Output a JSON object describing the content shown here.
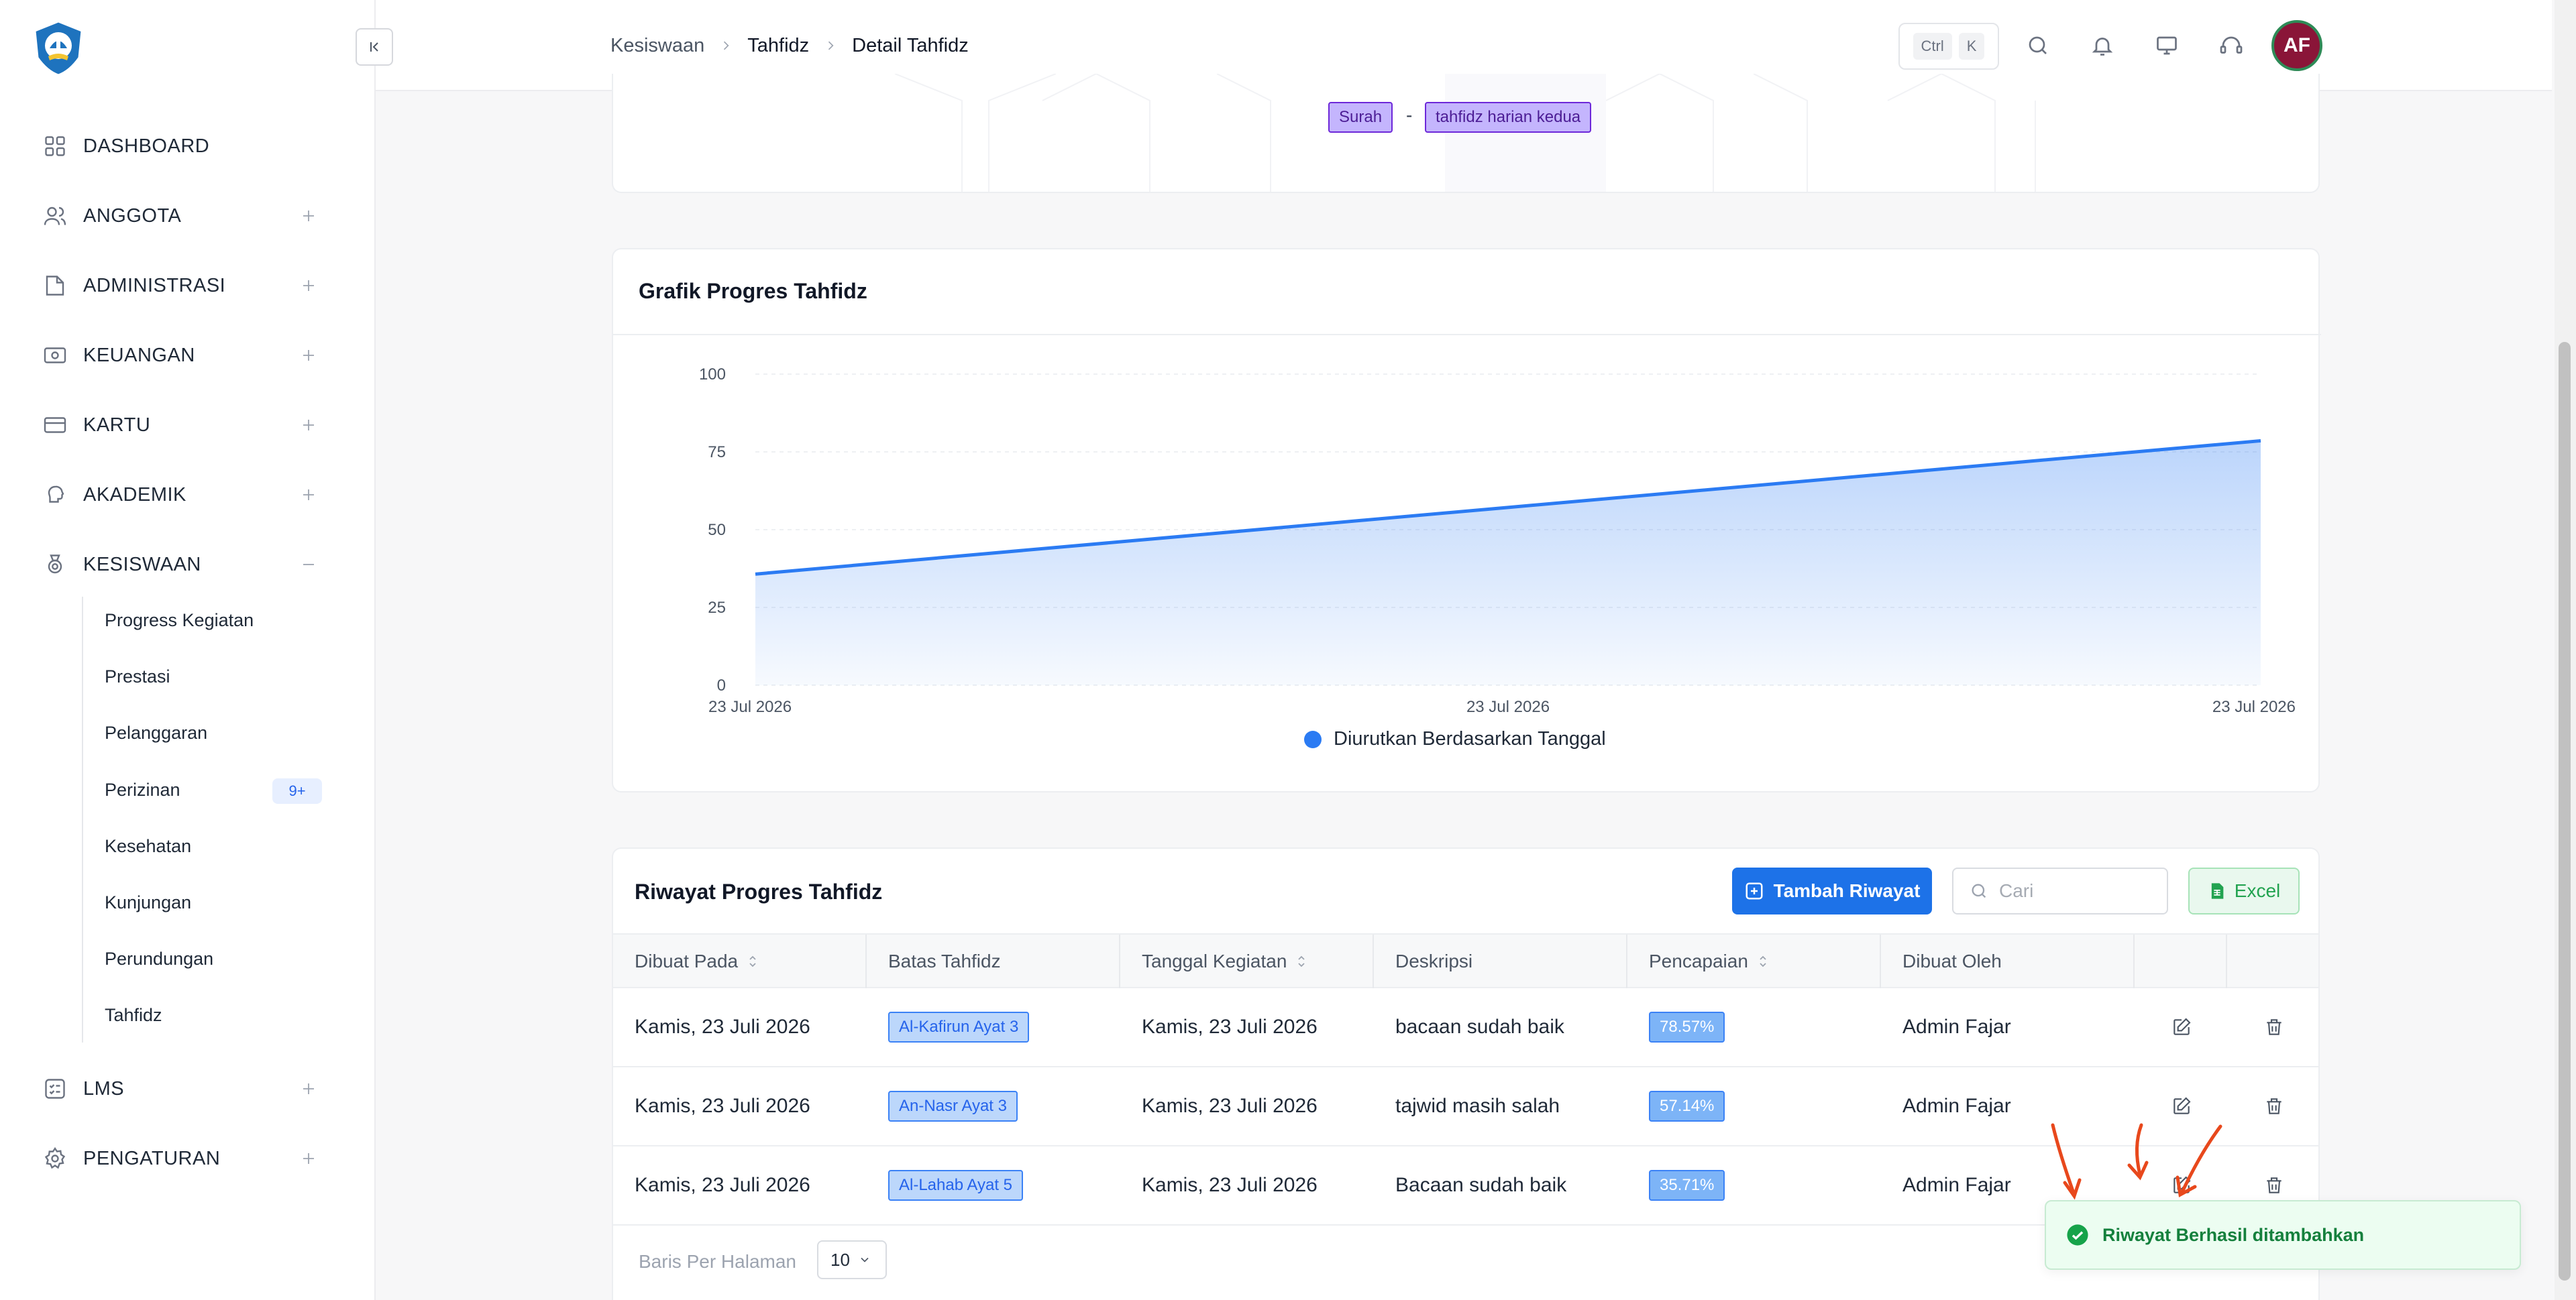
{
  "sidebar": {
    "items": [
      {
        "label": "DASHBOARD",
        "icon": "dashboard-grid-icon",
        "expandable": false
      },
      {
        "label": "ANGGOTA",
        "icon": "users-icon",
        "expandable": true
      },
      {
        "label": "ADMINISTRASI",
        "icon": "folder-icon",
        "expandable": true
      },
      {
        "label": "KEUANGAN",
        "icon": "money-icon",
        "expandable": true
      },
      {
        "label": "KARTU",
        "icon": "card-icon",
        "expandable": true
      },
      {
        "label": "AKADEMIK",
        "icon": "brain-icon",
        "expandable": true
      },
      {
        "label": "KESISWAAN",
        "icon": "medal-icon",
        "expandable": true,
        "expanded": true
      },
      {
        "label": "LMS",
        "icon": "checklist-icon",
        "expandable": true
      },
      {
        "label": "PENGATURAN",
        "icon": "gear-icon",
        "expandable": true
      }
    ],
    "submenu": [
      {
        "label": "Progress Kegiatan"
      },
      {
        "label": "Prestasi"
      },
      {
        "label": "Pelanggaran"
      },
      {
        "label": "Perizinan",
        "badge": "9+"
      },
      {
        "label": "Kesehatan"
      },
      {
        "label": "Kunjungan"
      },
      {
        "label": "Perundungan"
      },
      {
        "label": "Tahfidz"
      }
    ]
  },
  "header": {
    "breadcrumb": [
      "Kesiswaan",
      "Tahfidz",
      "Detail Tahfidz"
    ],
    "shortcut": [
      "Ctrl",
      "K"
    ],
    "avatar_initials": "AF",
    "accent_color": "#8a1538"
  },
  "top_card": {
    "tag_left": "Surah",
    "separator": "-",
    "tag_right": "tahfidz harian kedua"
  },
  "chart_card": {
    "title": "Grafik Progres Tahfidz"
  },
  "chart_data": {
    "type": "area",
    "title": "Grafik Progres Tahfidz",
    "xlabel": "",
    "ylabel": "",
    "x": [
      "23 Jul 2026",
      "23 Jul 2026",
      "23 Jul 2026"
    ],
    "series": [
      {
        "name": "Diurutkan Berdasarkan Tanggal",
        "values": [
          35.71,
          57.14,
          78.57
        ],
        "color": "#2b7bf3"
      }
    ],
    "ylim": [
      0,
      100
    ],
    "yticks": [
      0,
      25,
      50,
      75,
      100
    ],
    "grid": true,
    "legend_position": "bottom-center"
  },
  "table_card": {
    "title": "Riwayat Progres Tahfidz",
    "add_button": "Tambah Riwayat",
    "search_placeholder": "Cari",
    "excel_button": "Excel",
    "columns": [
      "Dibuat Pada",
      "Batas Tahfidz",
      "Tanggal Kegiatan",
      "Deskripsi",
      "Pencapaian",
      "Dibuat Oleh"
    ],
    "rows": [
      {
        "created": "Kamis, 23 Juli 2026",
        "limit": "Al-Kafirun Ayat 3",
        "date": "Kamis, 23 Juli 2026",
        "desc": "bacaan sudah baik",
        "pct": "78.57%",
        "by": "Admin Fajar"
      },
      {
        "created": "Kamis, 23 Juli 2026",
        "limit": "An-Nasr Ayat 3",
        "date": "Kamis, 23 Juli 2026",
        "desc": "tajwid masih salah",
        "pct": "57.14%",
        "by": "Admin Fajar"
      },
      {
        "created": "Kamis, 23 Juli 2026",
        "limit": "Al-Lahab Ayat 5",
        "date": "Kamis, 23 Juli 2026",
        "desc": "Bacaan sudah baik",
        "pct": "35.71%",
        "by": "Admin Fajar"
      }
    ],
    "rows_per_page_label": "Baris Per Halaman",
    "rows_per_page_value": "10"
  },
  "toast": {
    "message": "Riwayat Berhasil ditambahkan",
    "color": "#15803d"
  }
}
